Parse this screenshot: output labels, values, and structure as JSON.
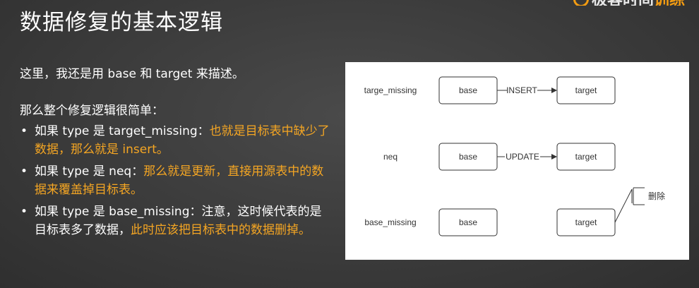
{
  "slide": {
    "title": "数据修复的基本逻辑",
    "logo_text_main": "极客时间",
    "logo_text_accent": "训练营"
  },
  "text": {
    "intro": "这里，我还是用 base 和 target 来描述。",
    "lead": "那么整个修复逻辑很简单：",
    "bullets": [
      {
        "normal": "如果 type 是 target_missing：",
        "highlight": "也就是目标表中缺少了数据，那么就是 insert。",
        "tail": ""
      },
      {
        "normal": "如果 type 是 neq：",
        "highlight": "那么就是更新，直接用源表中的数据来覆盖掉目标表。",
        "tail": ""
      },
      {
        "normal": "如果 type 是 base_missing：注意，这时候代表的是目标表多了数据，",
        "highlight": "此时应该把目标表中的数据删掉。",
        "tail": ""
      }
    ]
  },
  "diagram": {
    "rows": [
      {
        "label": "targe_missing",
        "base": "base",
        "edge": "INSERT",
        "target": "target"
      },
      {
        "label": "neq",
        "base": "base",
        "edge": "UPDATE",
        "target": "target"
      },
      {
        "label": "base_missing",
        "base": "base",
        "edge": "",
        "target": "target",
        "note": "删除"
      }
    ]
  },
  "colors": {
    "highlight": "#f5a623",
    "background": "#3b3b3b",
    "diagram_bg": "#ffffff"
  }
}
